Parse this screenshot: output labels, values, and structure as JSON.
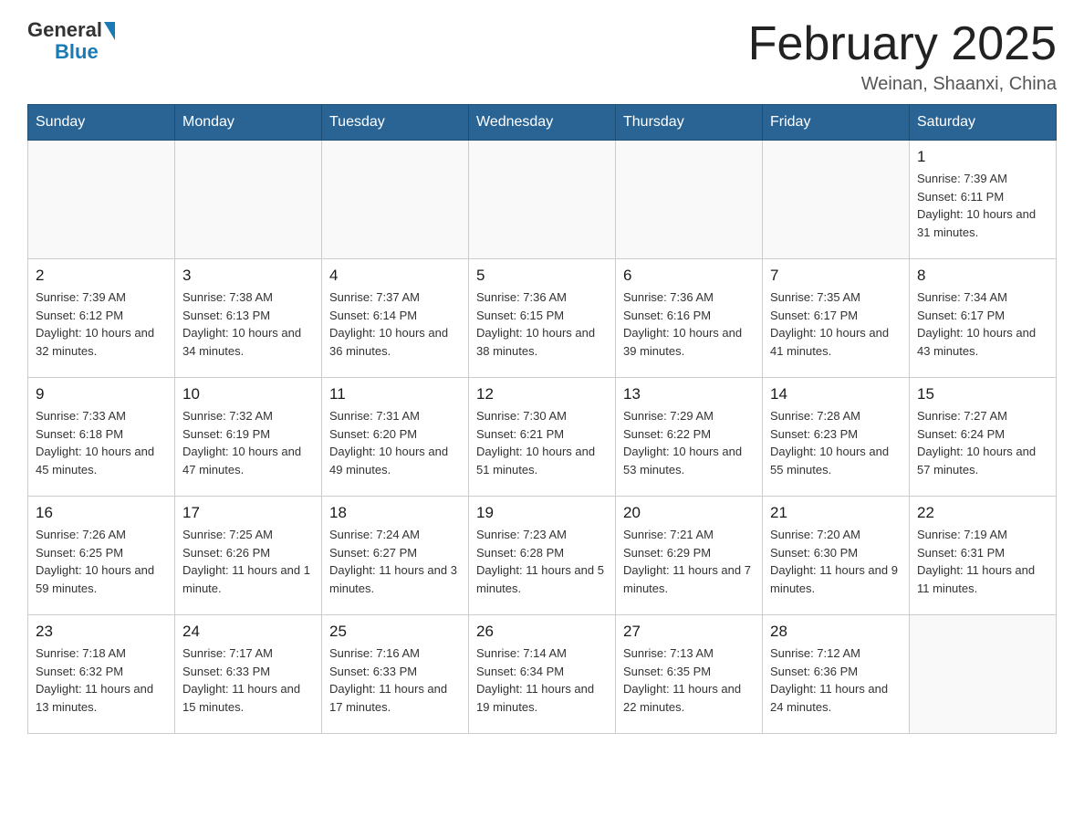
{
  "header": {
    "logo_general": "General",
    "logo_blue": "Blue",
    "month_title": "February 2025",
    "location": "Weinan, Shaanxi, China"
  },
  "days_of_week": [
    "Sunday",
    "Monday",
    "Tuesday",
    "Wednesday",
    "Thursday",
    "Friday",
    "Saturday"
  ],
  "weeks": [
    {
      "days": [
        {
          "number": "",
          "info": ""
        },
        {
          "number": "",
          "info": ""
        },
        {
          "number": "",
          "info": ""
        },
        {
          "number": "",
          "info": ""
        },
        {
          "number": "",
          "info": ""
        },
        {
          "number": "",
          "info": ""
        },
        {
          "number": "1",
          "info": "Sunrise: 7:39 AM\nSunset: 6:11 PM\nDaylight: 10 hours\nand 31 minutes."
        }
      ]
    },
    {
      "days": [
        {
          "number": "2",
          "info": "Sunrise: 7:39 AM\nSunset: 6:12 PM\nDaylight: 10 hours\nand 32 minutes."
        },
        {
          "number": "3",
          "info": "Sunrise: 7:38 AM\nSunset: 6:13 PM\nDaylight: 10 hours\nand 34 minutes."
        },
        {
          "number": "4",
          "info": "Sunrise: 7:37 AM\nSunset: 6:14 PM\nDaylight: 10 hours\nand 36 minutes."
        },
        {
          "number": "5",
          "info": "Sunrise: 7:36 AM\nSunset: 6:15 PM\nDaylight: 10 hours\nand 38 minutes."
        },
        {
          "number": "6",
          "info": "Sunrise: 7:36 AM\nSunset: 6:16 PM\nDaylight: 10 hours\nand 39 minutes."
        },
        {
          "number": "7",
          "info": "Sunrise: 7:35 AM\nSunset: 6:17 PM\nDaylight: 10 hours\nand 41 minutes."
        },
        {
          "number": "8",
          "info": "Sunrise: 7:34 AM\nSunset: 6:17 PM\nDaylight: 10 hours\nand 43 minutes."
        }
      ]
    },
    {
      "days": [
        {
          "number": "9",
          "info": "Sunrise: 7:33 AM\nSunset: 6:18 PM\nDaylight: 10 hours\nand 45 minutes."
        },
        {
          "number": "10",
          "info": "Sunrise: 7:32 AM\nSunset: 6:19 PM\nDaylight: 10 hours\nand 47 minutes."
        },
        {
          "number": "11",
          "info": "Sunrise: 7:31 AM\nSunset: 6:20 PM\nDaylight: 10 hours\nand 49 minutes."
        },
        {
          "number": "12",
          "info": "Sunrise: 7:30 AM\nSunset: 6:21 PM\nDaylight: 10 hours\nand 51 minutes."
        },
        {
          "number": "13",
          "info": "Sunrise: 7:29 AM\nSunset: 6:22 PM\nDaylight: 10 hours\nand 53 minutes."
        },
        {
          "number": "14",
          "info": "Sunrise: 7:28 AM\nSunset: 6:23 PM\nDaylight: 10 hours\nand 55 minutes."
        },
        {
          "number": "15",
          "info": "Sunrise: 7:27 AM\nSunset: 6:24 PM\nDaylight: 10 hours\nand 57 minutes."
        }
      ]
    },
    {
      "days": [
        {
          "number": "16",
          "info": "Sunrise: 7:26 AM\nSunset: 6:25 PM\nDaylight: 10 hours\nand 59 minutes."
        },
        {
          "number": "17",
          "info": "Sunrise: 7:25 AM\nSunset: 6:26 PM\nDaylight: 11 hours\nand 1 minute."
        },
        {
          "number": "18",
          "info": "Sunrise: 7:24 AM\nSunset: 6:27 PM\nDaylight: 11 hours\nand 3 minutes."
        },
        {
          "number": "19",
          "info": "Sunrise: 7:23 AM\nSunset: 6:28 PM\nDaylight: 11 hours\nand 5 minutes."
        },
        {
          "number": "20",
          "info": "Sunrise: 7:21 AM\nSunset: 6:29 PM\nDaylight: 11 hours\nand 7 minutes."
        },
        {
          "number": "21",
          "info": "Sunrise: 7:20 AM\nSunset: 6:30 PM\nDaylight: 11 hours\nand 9 minutes."
        },
        {
          "number": "22",
          "info": "Sunrise: 7:19 AM\nSunset: 6:31 PM\nDaylight: 11 hours\nand 11 minutes."
        }
      ]
    },
    {
      "days": [
        {
          "number": "23",
          "info": "Sunrise: 7:18 AM\nSunset: 6:32 PM\nDaylight: 11 hours\nand 13 minutes."
        },
        {
          "number": "24",
          "info": "Sunrise: 7:17 AM\nSunset: 6:33 PM\nDaylight: 11 hours\nand 15 minutes."
        },
        {
          "number": "25",
          "info": "Sunrise: 7:16 AM\nSunset: 6:33 PM\nDaylight: 11 hours\nand 17 minutes."
        },
        {
          "number": "26",
          "info": "Sunrise: 7:14 AM\nSunset: 6:34 PM\nDaylight: 11 hours\nand 19 minutes."
        },
        {
          "number": "27",
          "info": "Sunrise: 7:13 AM\nSunset: 6:35 PM\nDaylight: 11 hours\nand 22 minutes."
        },
        {
          "number": "28",
          "info": "Sunrise: 7:12 AM\nSunset: 6:36 PM\nDaylight: 11 hours\nand 24 minutes."
        },
        {
          "number": "",
          "info": ""
        }
      ]
    }
  ]
}
